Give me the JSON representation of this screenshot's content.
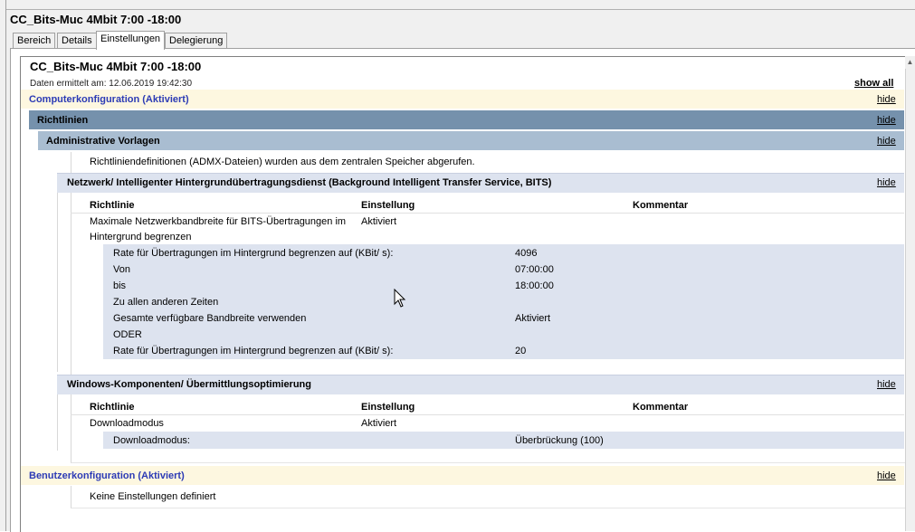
{
  "window": {
    "title": "CC_Bits-Muc 4Mbit 7:00 -18:00"
  },
  "tabs": [
    {
      "label": "Bereich"
    },
    {
      "label": "Details"
    },
    {
      "label": "Einstellungen"
    },
    {
      "label": "Delegierung"
    }
  ],
  "report": {
    "title": "CC_Bits-Muc 4Mbit 7:00 -18:00",
    "collected": "Daten ermittelt am: 12.06.2019 19:42:30",
    "show_all": "show all",
    "hide": "hide",
    "computer": {
      "title": "Computerkonfiguration (Aktiviert)",
      "policies": "Richtlinien",
      "admin_templates": "Administrative Vorlagen",
      "admx_note": "Richtliniendefinitionen (ADMX-Dateien) wurden aus dem zentralen Speicher abgerufen.",
      "bits": {
        "title": "Netzwerk/ Intelligenter Hintergrundübertragungsdienst (Background Intelligent Transfer Service, BITS)",
        "col_policy": "Richtlinie",
        "col_setting": "Einstellung",
        "col_comment": "Kommentar",
        "policy_line1": "Maximale Netzwerkbandbreite für BITS-Übertragungen im",
        "policy_line2": "Hintergrund begrenzen",
        "policy_value": "Aktiviert",
        "details": [
          {
            "label": "Rate für Übertragungen im Hintergrund begrenzen auf (KBit/ s):",
            "value": "4096"
          },
          {
            "label": "Von",
            "value": "07:00:00"
          },
          {
            "label": "bis",
            "value": "18:00:00"
          },
          {
            "label": "Zu allen anderen Zeiten",
            "value": ""
          },
          {
            "label": "Gesamte verfügbare Bandbreite verwenden",
            "value": "Aktiviert"
          },
          {
            "label": "ODER",
            "value": ""
          },
          {
            "label": "Rate für Übertragungen im Hintergrund begrenzen auf (KBit/ s):",
            "value": "20"
          }
        ]
      },
      "delivery": {
        "title": "Windows-Komponenten/ Übermittlungsoptimierung",
        "col_policy": "Richtlinie",
        "col_setting": "Einstellung",
        "col_comment": "Kommentar",
        "policy": "Downloadmodus",
        "policy_value": "Aktiviert",
        "detail_label": "Downloadmodus:",
        "detail_value": "Überbrückung (100)"
      }
    },
    "user": {
      "title": "Benutzerkonfiguration (Aktiviert)",
      "note": "Keine Einstellungen definiert"
    }
  }
}
